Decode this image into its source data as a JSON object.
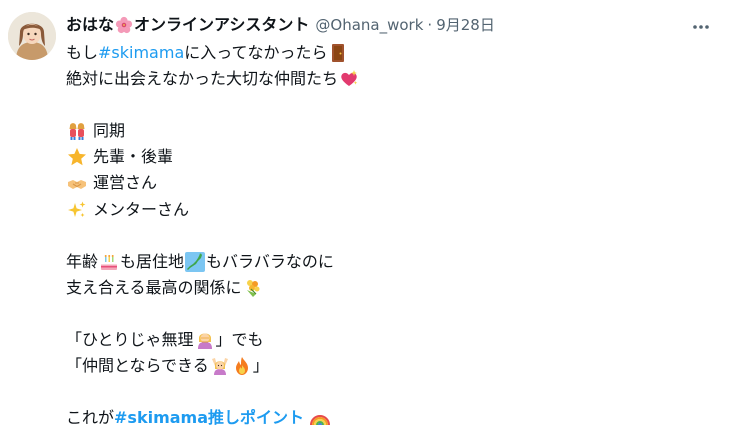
{
  "author": {
    "display_name": "おはな",
    "display_name_suffix": "オンラインアシスタント",
    "name_emoji_icon": "hibiscus-icon",
    "handle": "@Ohana_work",
    "separator": "·",
    "date": "9月28日"
  },
  "post": {
    "lines": [
      {
        "text": "もし ",
        "hashtag": "#skimama",
        "after": " に入ってなかったら",
        "icon": "door-icon"
      },
      {
        "text": "絶対に出会えなかった大切な仲間たち",
        "icon": "sparkling-heart-icon"
      },
      {
        "text": ""
      },
      {
        "icon": "two-women-icon",
        "text": "同期"
      },
      {
        "icon": "star-icon",
        "text": "先輩・後輩"
      },
      {
        "icon": "handshake-icon",
        "text": "運営さん"
      },
      {
        "icon": "sparkles-icon",
        "text": "メンターさん"
      },
      {
        "text": ""
      },
      {
        "text_a": "年齢",
        "icon_a": "birthday-cake-icon",
        "text_b": "も居住地",
        "icon_b": "japan-map-icon",
        "text_c": "もバラバラなのに"
      },
      {
        "text": "支え合える最高の関係に",
        "icon": "bouquet-icon"
      },
      {
        "text": ""
      },
      {
        "text": "「ひとりじゃ無理",
        "icon": "person-facepalming-icon",
        "after": "」でも"
      },
      {
        "text": "「仲間とならできる",
        "icon_a": "person-raising-hands-icon",
        "icon_b": "fire-icon",
        "after": "」"
      },
      {
        "text": ""
      },
      {
        "text": "これが ",
        "hashtag": "#skimama推しポイント",
        "icon": "rainbow-icon"
      }
    ]
  },
  "colors": {
    "text": "#0f1419",
    "secondary": "#536471",
    "link": "#1d9bf0"
  }
}
